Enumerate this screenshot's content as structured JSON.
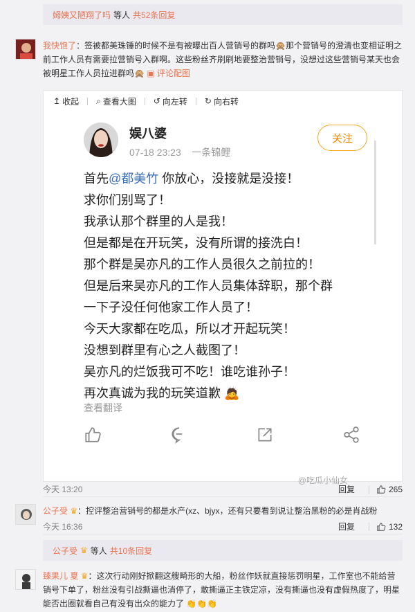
{
  "top_reply_bar": {
    "name": "姆姨又陋翔了吗",
    "suffix": "等人",
    "total": "共52条回复"
  },
  "comment1": {
    "name": "我快饱了",
    "text_a": "：签被都美珠锤的时候不是有被曝出百人营销号的群吗",
    "text_b": "那个营销号的澄清也变相证明之前工作人员有需要拉营销号入群啊。这些粉丝齐刷刷地要整治营销号，没想过这些营销号某天也会被明星工作人员拉进群吗",
    "pic_link": "评论配图",
    "pic_icon": "image-icon"
  },
  "media_toolbar": {
    "collapse": "收起",
    "view_large": "查看大图",
    "rotate_left": "向左转",
    "rotate_right": "向右转"
  },
  "post": {
    "author": "娱八婆",
    "date": "07-18 23:23",
    "source": "一条锦鲤",
    "follow": "关注",
    "mention_prefix": "首先",
    "mention": "@都美竹",
    "line1_rest": " 你放心，没接就是没接！",
    "lines": [
      "求你们别骂了！",
      "我承认那个群里的人是我！",
      "但是都是在开玩笑，没有所谓的接洗白！",
      "那个群是吴亦凡的工作人员很久之前拉的！",
      "但是后来吴亦凡的工作人员集体辞职，那个群",
      "一下子没任何他家工作人员了！",
      "今天大家都在吃瓜，所以才开起玩笑！",
      "没想到群里有心之人截图了！",
      "吴亦凡的烂饭我可不吃！谁吃谁孙子！",
      "再次真诚为我的玩笑道歉"
    ],
    "translate": "查看翻译",
    "watermark": "@吃瓜小仙女"
  },
  "comment1_meta": {
    "time": "今天 13:20",
    "reply": "回复",
    "likes": "265"
  },
  "comment2": {
    "name": "公子受",
    "text": "：控评整治营销号的都是水产(xz、bjyx，还有只要看到说让整治黑粉的必是肖战粉"
  },
  "comment2_meta": {
    "time": "今天 16:36",
    "reply": "回复",
    "likes": "132"
  },
  "reply_bar2": {
    "name": "公子受",
    "suffix": "等人",
    "total": "共10条回复"
  },
  "comment3": {
    "name": "臻果儿 夏",
    "text": "：这次行动刚好掀翻这艘畸形的大船，粉丝作妖就直接惩罚明星，工作室也不能给营销号下单了，粉丝没有引战撕逼也消停了，敢撕逼正主铁定凉，没有撕逼也没有虚假热度了，明星能否出圈就看自己有没有出众的能力了"
  },
  "colors": {
    "accent": "#eb7350",
    "follow": "#f5a623",
    "mention": "#3a6fb5"
  }
}
